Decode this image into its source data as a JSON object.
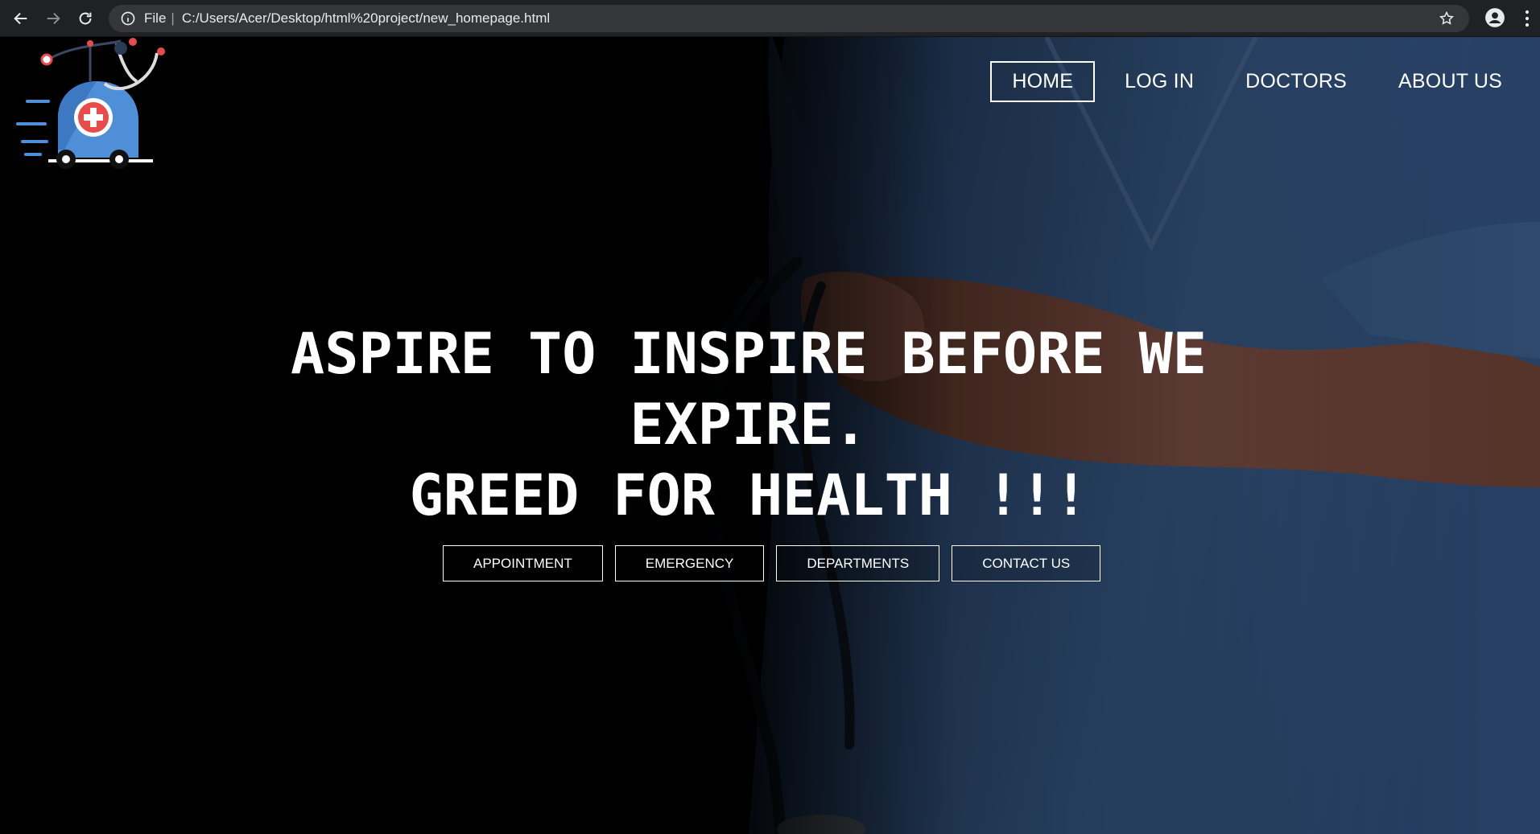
{
  "browser": {
    "scheme_label": "File",
    "url": "C:/Users/Acer/Desktop/html%20project/new_homepage.html"
  },
  "nav": {
    "items": [
      {
        "label": "HOME",
        "active": true
      },
      {
        "label": "LOG IN",
        "active": false
      },
      {
        "label": "DOCTORS",
        "active": false
      },
      {
        "label": "ABOUT US",
        "active": false
      }
    ]
  },
  "hero": {
    "line1": "ASPIRE TO INSPIRE BEFORE WE",
    "line2": "EXPIRE.",
    "line3": "GREED FOR HEALTH !!!"
  },
  "buttons": {
    "appointment": "APPOINTMENT",
    "emergency": "EMERGENCY",
    "departments": "DEPARTMENTS",
    "contact": "CONTACT US"
  },
  "icons": {
    "back": "back-arrow-icon",
    "forward": "forward-arrow-icon",
    "reload": "reload-icon",
    "info": "info-icon",
    "star": "star-icon",
    "profile": "profile-icon",
    "menu": "more-vert-icon",
    "logo": "ambulance-stethoscope-logo"
  },
  "colors": {
    "chrome_bg": "#202124",
    "omnibox_bg": "#35363a",
    "logo_blue": "#4f8fd8",
    "logo_red": "#e94b4b",
    "scrubs_blue": "#3f6fae"
  }
}
